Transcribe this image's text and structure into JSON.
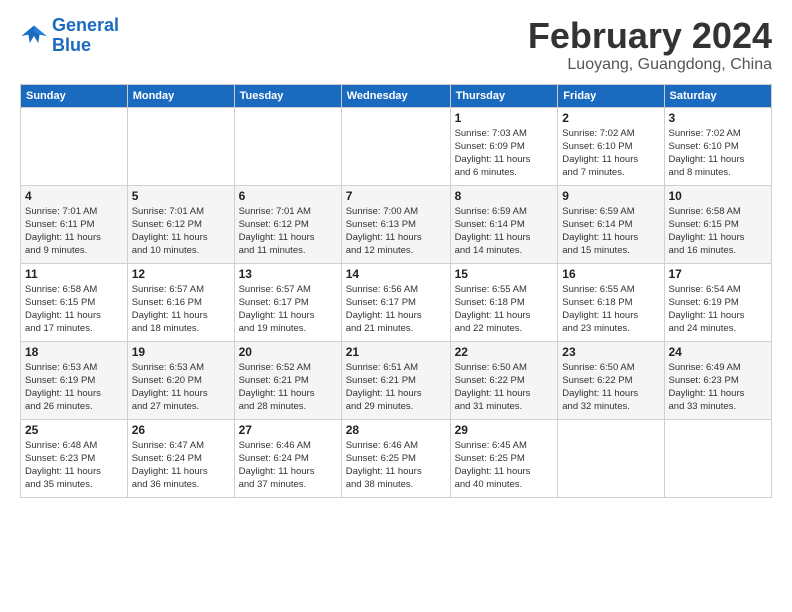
{
  "logo": {
    "line1": "General",
    "line2": "Blue"
  },
  "title": "February 2024",
  "location": "Luoyang, Guangdong, China",
  "days_of_week": [
    "Sunday",
    "Monday",
    "Tuesday",
    "Wednesday",
    "Thursday",
    "Friday",
    "Saturday"
  ],
  "weeks": [
    [
      {
        "num": "",
        "detail": ""
      },
      {
        "num": "",
        "detail": ""
      },
      {
        "num": "",
        "detail": ""
      },
      {
        "num": "",
        "detail": ""
      },
      {
        "num": "1",
        "detail": "Sunrise: 7:03 AM\nSunset: 6:09 PM\nDaylight: 11 hours\nand 6 minutes."
      },
      {
        "num": "2",
        "detail": "Sunrise: 7:02 AM\nSunset: 6:10 PM\nDaylight: 11 hours\nand 7 minutes."
      },
      {
        "num": "3",
        "detail": "Sunrise: 7:02 AM\nSunset: 6:10 PM\nDaylight: 11 hours\nand 8 minutes."
      }
    ],
    [
      {
        "num": "4",
        "detail": "Sunrise: 7:01 AM\nSunset: 6:11 PM\nDaylight: 11 hours\nand 9 minutes."
      },
      {
        "num": "5",
        "detail": "Sunrise: 7:01 AM\nSunset: 6:12 PM\nDaylight: 11 hours\nand 10 minutes."
      },
      {
        "num": "6",
        "detail": "Sunrise: 7:01 AM\nSunset: 6:12 PM\nDaylight: 11 hours\nand 11 minutes."
      },
      {
        "num": "7",
        "detail": "Sunrise: 7:00 AM\nSunset: 6:13 PM\nDaylight: 11 hours\nand 12 minutes."
      },
      {
        "num": "8",
        "detail": "Sunrise: 6:59 AM\nSunset: 6:14 PM\nDaylight: 11 hours\nand 14 minutes."
      },
      {
        "num": "9",
        "detail": "Sunrise: 6:59 AM\nSunset: 6:14 PM\nDaylight: 11 hours\nand 15 minutes."
      },
      {
        "num": "10",
        "detail": "Sunrise: 6:58 AM\nSunset: 6:15 PM\nDaylight: 11 hours\nand 16 minutes."
      }
    ],
    [
      {
        "num": "11",
        "detail": "Sunrise: 6:58 AM\nSunset: 6:15 PM\nDaylight: 11 hours\nand 17 minutes."
      },
      {
        "num": "12",
        "detail": "Sunrise: 6:57 AM\nSunset: 6:16 PM\nDaylight: 11 hours\nand 18 minutes."
      },
      {
        "num": "13",
        "detail": "Sunrise: 6:57 AM\nSunset: 6:17 PM\nDaylight: 11 hours\nand 19 minutes."
      },
      {
        "num": "14",
        "detail": "Sunrise: 6:56 AM\nSunset: 6:17 PM\nDaylight: 11 hours\nand 21 minutes."
      },
      {
        "num": "15",
        "detail": "Sunrise: 6:55 AM\nSunset: 6:18 PM\nDaylight: 11 hours\nand 22 minutes."
      },
      {
        "num": "16",
        "detail": "Sunrise: 6:55 AM\nSunset: 6:18 PM\nDaylight: 11 hours\nand 23 minutes."
      },
      {
        "num": "17",
        "detail": "Sunrise: 6:54 AM\nSunset: 6:19 PM\nDaylight: 11 hours\nand 24 minutes."
      }
    ],
    [
      {
        "num": "18",
        "detail": "Sunrise: 6:53 AM\nSunset: 6:19 PM\nDaylight: 11 hours\nand 26 minutes."
      },
      {
        "num": "19",
        "detail": "Sunrise: 6:53 AM\nSunset: 6:20 PM\nDaylight: 11 hours\nand 27 minutes."
      },
      {
        "num": "20",
        "detail": "Sunrise: 6:52 AM\nSunset: 6:21 PM\nDaylight: 11 hours\nand 28 minutes."
      },
      {
        "num": "21",
        "detail": "Sunrise: 6:51 AM\nSunset: 6:21 PM\nDaylight: 11 hours\nand 29 minutes."
      },
      {
        "num": "22",
        "detail": "Sunrise: 6:50 AM\nSunset: 6:22 PM\nDaylight: 11 hours\nand 31 minutes."
      },
      {
        "num": "23",
        "detail": "Sunrise: 6:50 AM\nSunset: 6:22 PM\nDaylight: 11 hours\nand 32 minutes."
      },
      {
        "num": "24",
        "detail": "Sunrise: 6:49 AM\nSunset: 6:23 PM\nDaylight: 11 hours\nand 33 minutes."
      }
    ],
    [
      {
        "num": "25",
        "detail": "Sunrise: 6:48 AM\nSunset: 6:23 PM\nDaylight: 11 hours\nand 35 minutes."
      },
      {
        "num": "26",
        "detail": "Sunrise: 6:47 AM\nSunset: 6:24 PM\nDaylight: 11 hours\nand 36 minutes."
      },
      {
        "num": "27",
        "detail": "Sunrise: 6:46 AM\nSunset: 6:24 PM\nDaylight: 11 hours\nand 37 minutes."
      },
      {
        "num": "28",
        "detail": "Sunrise: 6:46 AM\nSunset: 6:25 PM\nDaylight: 11 hours\nand 38 minutes."
      },
      {
        "num": "29",
        "detail": "Sunrise: 6:45 AM\nSunset: 6:25 PM\nDaylight: 11 hours\nand 40 minutes."
      },
      {
        "num": "",
        "detail": ""
      },
      {
        "num": "",
        "detail": ""
      }
    ]
  ]
}
